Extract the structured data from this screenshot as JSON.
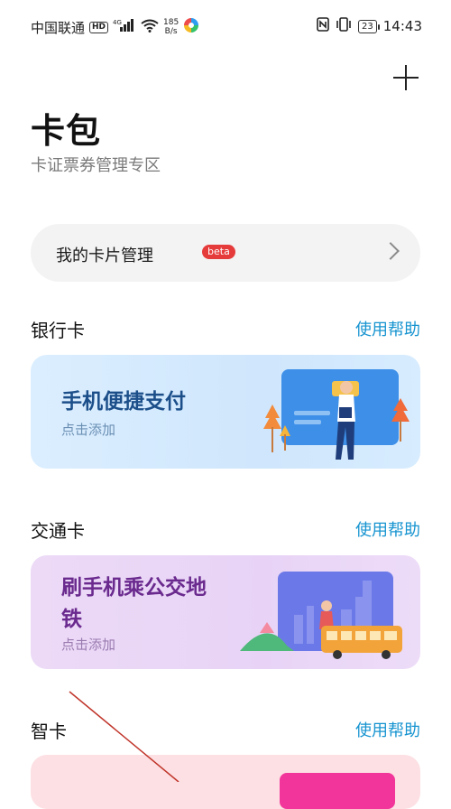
{
  "status_bar": {
    "carrier": "中国联通",
    "hd_badge": "HD",
    "network": "4G",
    "speed_value": "185",
    "speed_unit": "B/s",
    "battery": "23",
    "time": "14:43"
  },
  "header": {
    "title": "卡包",
    "subtitle": "卡证票券管理专区"
  },
  "manage": {
    "label": "我的卡片管理",
    "badge": "beta"
  },
  "sections": {
    "bank": {
      "title": "银行卡",
      "help": "使用帮助",
      "card_title": "手机便捷支付",
      "card_sub": "点击添加"
    },
    "transit": {
      "title": "交通卡",
      "help": "使用帮助",
      "card_title_line1": "刷手机乘公交地",
      "card_title_line2": "铁",
      "card_sub": "点击添加"
    },
    "smart": {
      "title": "智卡",
      "help": "使用帮助"
    }
  },
  "colors": {
    "accent_link": "#1794d0",
    "bank_title": "#1c4f8a",
    "bank_sub": "#6b8fb3",
    "transit_title": "#6a2a8e",
    "transit_sub": "#9a7bb0",
    "beta": "#e63b3b"
  }
}
